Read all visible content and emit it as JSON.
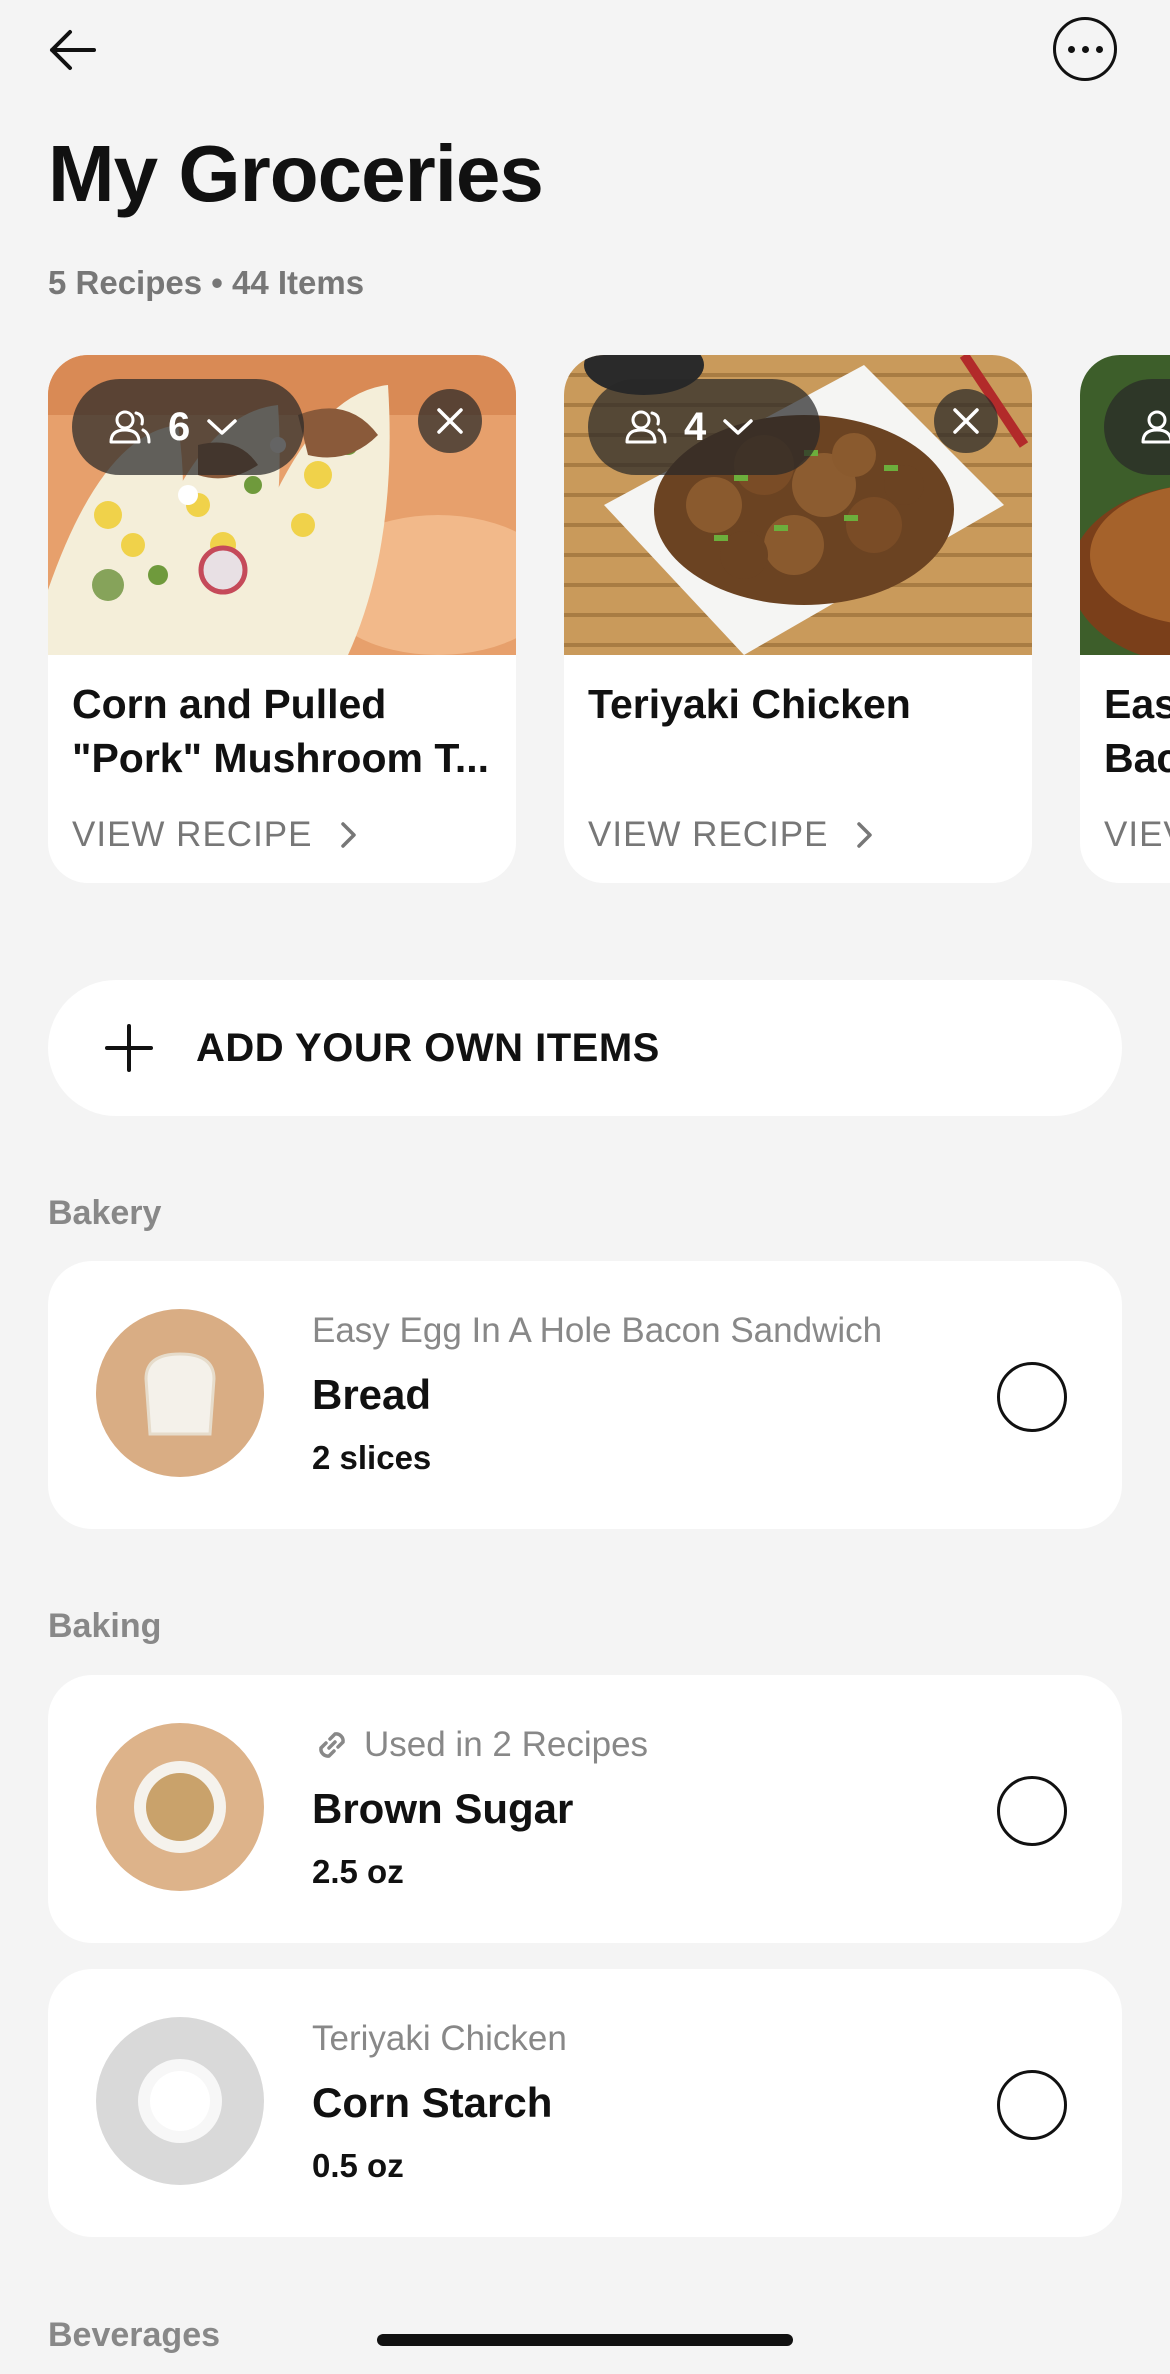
{
  "header": {
    "title": "My Groceries",
    "subtitle": "5 Recipes • 44 Items",
    "back_icon": "arrow-left-icon",
    "more_icon": "more-horizontal-icon"
  },
  "recipes": [
    {
      "servings": "6",
      "title": "Corn and Pulled \"Pork\" Mushroom T...",
      "view_label": "VIEW RECIPE",
      "image": "tacos-photo"
    },
    {
      "servings": "4",
      "title": "Teriyaki Chicken",
      "view_label": "VIEW RECIPE",
      "image": "teriyaki-chicken-photo"
    },
    {
      "servings": "",
      "title": "Eas\nBac",
      "view_label": "VIEV",
      "image": "egg-bacon-sandwich-photo"
    }
  ],
  "add_items": {
    "label": "ADD YOUR OWN ITEMS"
  },
  "sections": [
    {
      "title": "Bakery",
      "items": [
        {
          "source": "Easy Egg In A Hole Bacon Sandwich",
          "name": "Bread",
          "qty": "2 slices",
          "checked": false
        }
      ]
    },
    {
      "title": "Baking",
      "items": [
        {
          "source": "Used in 2 Recipes",
          "source_icon": "link-icon",
          "name": "Brown Sugar",
          "qty": "2.5 oz",
          "checked": false
        },
        {
          "source": "Teriyaki Chicken",
          "name": "Corn Starch",
          "qty": "0.5 oz",
          "checked": false
        }
      ]
    },
    {
      "title": "Beverages",
      "items": []
    }
  ],
  "colors": {
    "background": "#f4f4f4",
    "card": "#ffffff",
    "muted_text": "#777777",
    "text": "#111111"
  }
}
